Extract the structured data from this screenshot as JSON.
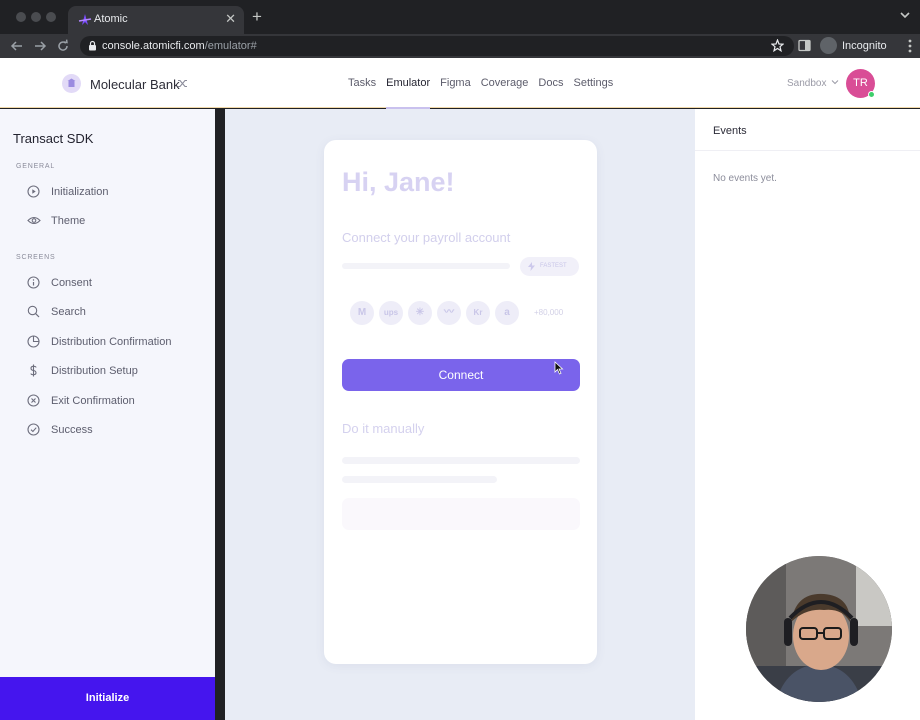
{
  "browser": {
    "tab_title": "Atomic",
    "tab_close": "✕",
    "new_tab": "+",
    "url_domain": "console.atomicfi.com",
    "url_path": "/emulator#",
    "profile_label": "Incognito"
  },
  "header": {
    "bank_name": "Molecular Bank",
    "nav": [
      "Tasks",
      "Emulator",
      "Figma",
      "Coverage",
      "Docs",
      "Settings"
    ],
    "active_nav": "Emulator",
    "environment": "Sandbox",
    "avatar_initials": "TR",
    "accent_color": "#4515ee"
  },
  "sidebar": {
    "title": "Transact SDK",
    "general_label": "GENERAL",
    "general_items": [
      {
        "label": "Initialization",
        "icon": "play-circle-icon"
      },
      {
        "label": "Theme",
        "icon": "eye-icon"
      }
    ],
    "screens_label": "SCREENS",
    "screen_items": [
      {
        "label": "Consent",
        "icon": "info-circle-icon"
      },
      {
        "label": "Search",
        "icon": "search-icon"
      },
      {
        "label": "Distribution Confirmation",
        "icon": "pie-chart-icon"
      },
      {
        "label": "Distribution Setup",
        "icon": "dollar-icon"
      },
      {
        "label": "Exit Confirmation",
        "icon": "x-circle-icon"
      },
      {
        "label": "Success",
        "icon": "check-circle-icon"
      }
    ],
    "initialize_label": "Initialize"
  },
  "emulator": {
    "greeting": "Hi, Jane!",
    "subheading": "Connect your payroll account",
    "fastest_badge": "FASTEST",
    "employers": [
      {
        "glyph": "M",
        "icon": "mcdonalds-logo"
      },
      {
        "glyph": "ups",
        "icon": "ups-logo"
      },
      {
        "glyph": "✳",
        "icon": "walmart-logo"
      },
      {
        "glyph": "〰",
        "icon": "nike-logo"
      },
      {
        "glyph": "Kr",
        "icon": "kroger-logo"
      },
      {
        "glyph": "a",
        "icon": "amazon-logo"
      }
    ],
    "more_count": "+80,000",
    "connect_label": "Connect",
    "manual_label": "Do it manually"
  },
  "events": {
    "title": "Events",
    "empty_text": "No events yet."
  }
}
